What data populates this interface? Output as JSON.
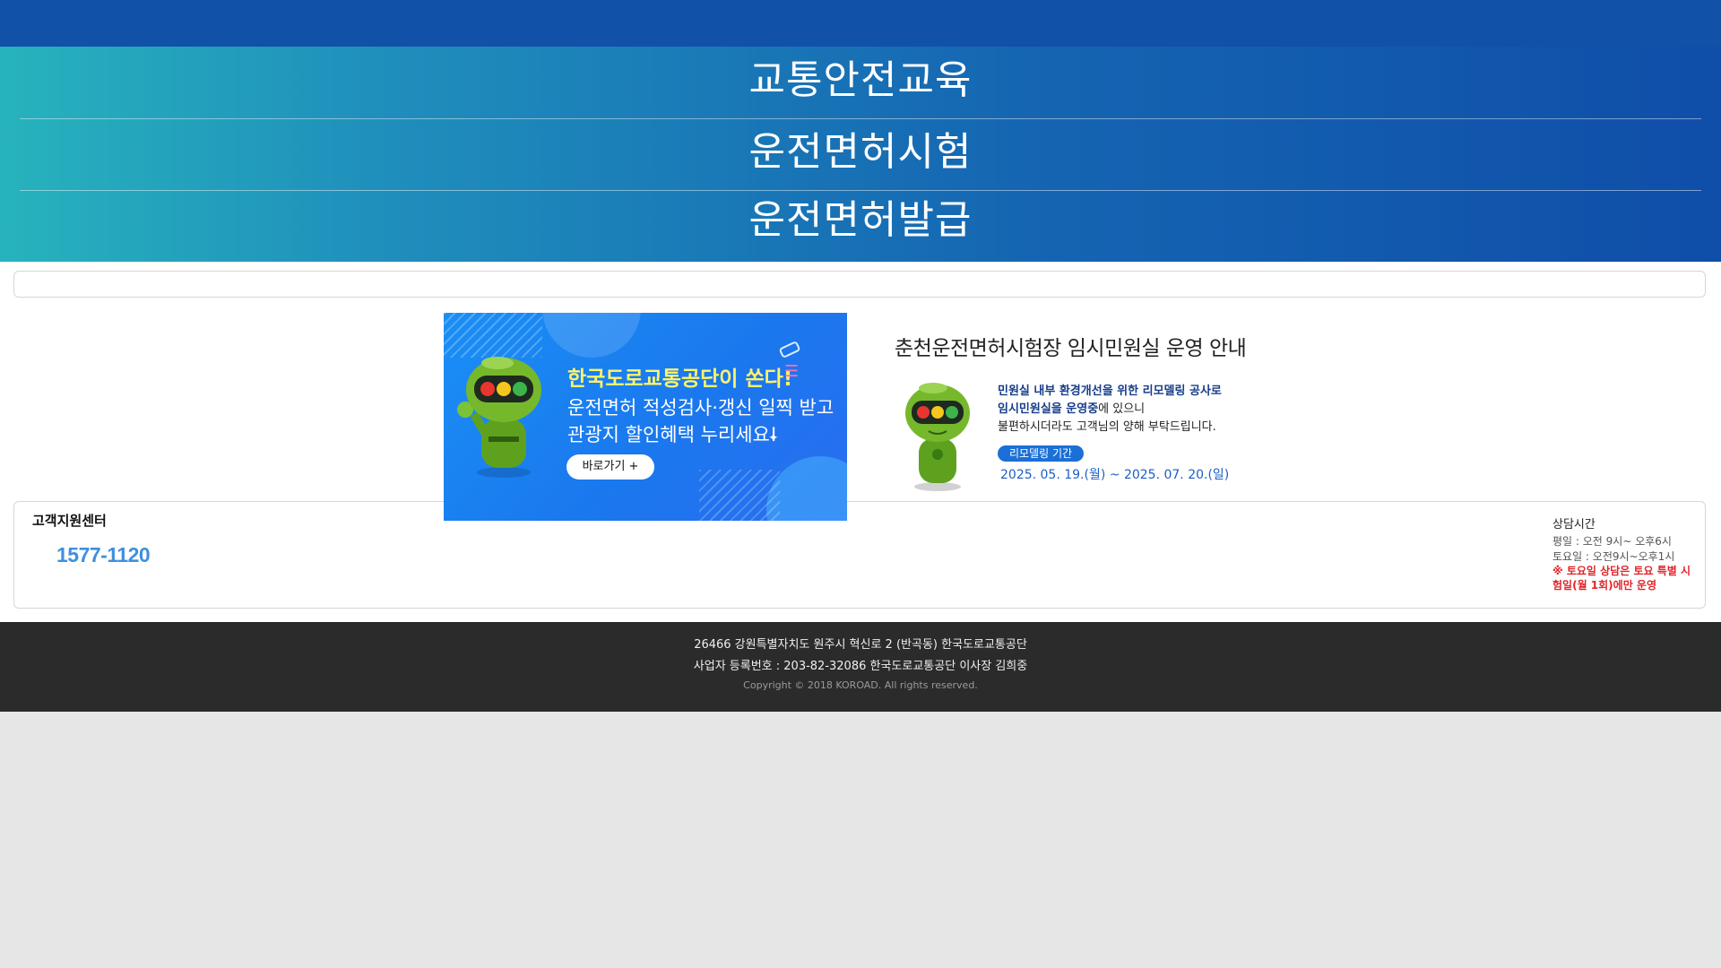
{
  "menu": {
    "items": [
      {
        "label": "교통안전교육"
      },
      {
        "label": "운전면허시험"
      },
      {
        "label": "운전면허발급"
      }
    ]
  },
  "promo_banner": {
    "headline": "한국도로교통공단이 쏜다!",
    "line1": "운전면허 적성검사·갱신 일찍 받고",
    "line2": "관광지 할인혜택 누리세요!",
    "button_label": "바로가기 +"
  },
  "notice_banner": {
    "title": "춘천운전면허시험장 임시민원실 운영 안내",
    "line1": "민원실 내부 환경개선을 위한 리모델링 공사로",
    "line2_bold": "임시민원실을 운영중",
    "line2_rest": "에 있으니",
    "line3": "불편하시더라도 고객님의 양해 부탁드립니다.",
    "pill": "리모델링 기간",
    "dates": "2025. 05. 19.(월) ~ 2025. 07. 20.(일)"
  },
  "customer_center": {
    "title": "고객지원센터",
    "phone": "1577-1120",
    "hours_title": "상담시간",
    "weekday": "평일 : 오전 9시~ 오후6시",
    "saturday": "토요일 : 오전9시~오후1시",
    "note": "※ 토요일 상담은 토요 특별 시험일(월 1회)에만 운영"
  },
  "footer": {
    "address": "26466 강원특별자치도 원주시 혁신로 2 (반곡동) 한국도로교통공단",
    "registration": "사업자 등록번호 : 203-82-32086 한국도로교통공단 이사장 김희중",
    "copyright": "Copyright © 2018 KOROAD. All rights reserved."
  },
  "colors": {
    "topbar": "#1151a8",
    "hero_start": "#27b3bd",
    "hero_end": "#0f4ea9",
    "phone": "#3f8fe0",
    "footer_bg": "#2b2b2b",
    "note_red": "#e0252a"
  },
  "icons": [
    "traffic-light-mascot-icon",
    "traffic-light-mascot-bow-icon"
  ]
}
